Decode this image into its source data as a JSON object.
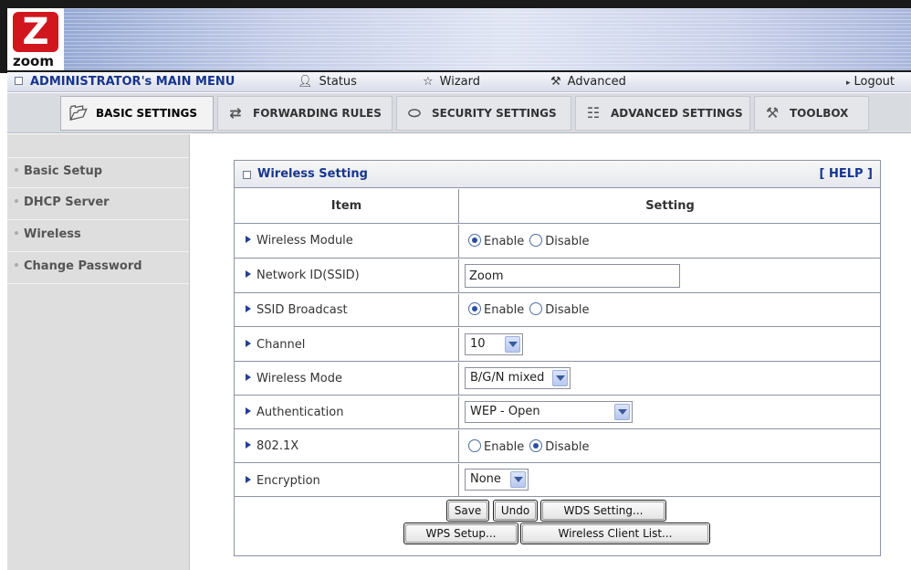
{
  "logo": {
    "letter": "Z",
    "word": "zoom"
  },
  "main_menu": {
    "title": "ADMINISTRATOR's MAIN MENU",
    "status": "Status",
    "wizard": "Wizard",
    "advanced": "Advanced",
    "logout": "Logout"
  },
  "tabs": [
    {
      "label": "BASIC SETTINGS",
      "icon": "folder-icon",
      "active": true
    },
    {
      "label": "FORWARDING RULES",
      "icon": "arrows-icon",
      "active": false
    },
    {
      "label": "SECURITY SETTINGS",
      "icon": "lock-icon",
      "active": false
    },
    {
      "label": "ADVANCED SETTINGS",
      "icon": "clipboard-icon",
      "active": false
    },
    {
      "label": "TOOLBOX",
      "icon": "toolbox-icon",
      "active": false
    }
  ],
  "sidebar": {
    "items": [
      {
        "label": "Basic Setup"
      },
      {
        "label": "DHCP Server"
      },
      {
        "label": "Wireless"
      },
      {
        "label": "Change Password"
      }
    ]
  },
  "panel": {
    "title": "Wireless Setting",
    "help": "[ HELP ]",
    "col_item": "Item",
    "col_setting": "Setting",
    "rows": {
      "wireless_module": {
        "label": "Wireless Module",
        "opt1": "Enable",
        "opt2": "Disable",
        "selected": "Enable"
      },
      "ssid": {
        "label": "Network ID(SSID)",
        "value": "Zoom"
      },
      "ssid_broadcast": {
        "label": "SSID Broadcast",
        "opt1": "Enable",
        "opt2": "Disable",
        "selected": "Enable"
      },
      "channel": {
        "label": "Channel",
        "value": "10"
      },
      "wireless_mode": {
        "label": "Wireless Mode",
        "value": "B/G/N mixed"
      },
      "authentication": {
        "label": "Authentication",
        "value": "WEP - Open"
      },
      "dot1x": {
        "label": "802.1X",
        "opt1": "Enable",
        "opt2": "Disable",
        "selected": "Disable"
      },
      "encryption": {
        "label": "Encryption",
        "value": "None"
      }
    },
    "buttons": {
      "save": "Save",
      "undo": "Undo",
      "wds": "WDS Setting...",
      "wps": "WPS Setup...",
      "client_list": "Wireless Client List..."
    }
  },
  "colors": {
    "accent_blue": "#17358c",
    "logo_red": "#d2161e",
    "sidebar_bg": "#dedede"
  }
}
